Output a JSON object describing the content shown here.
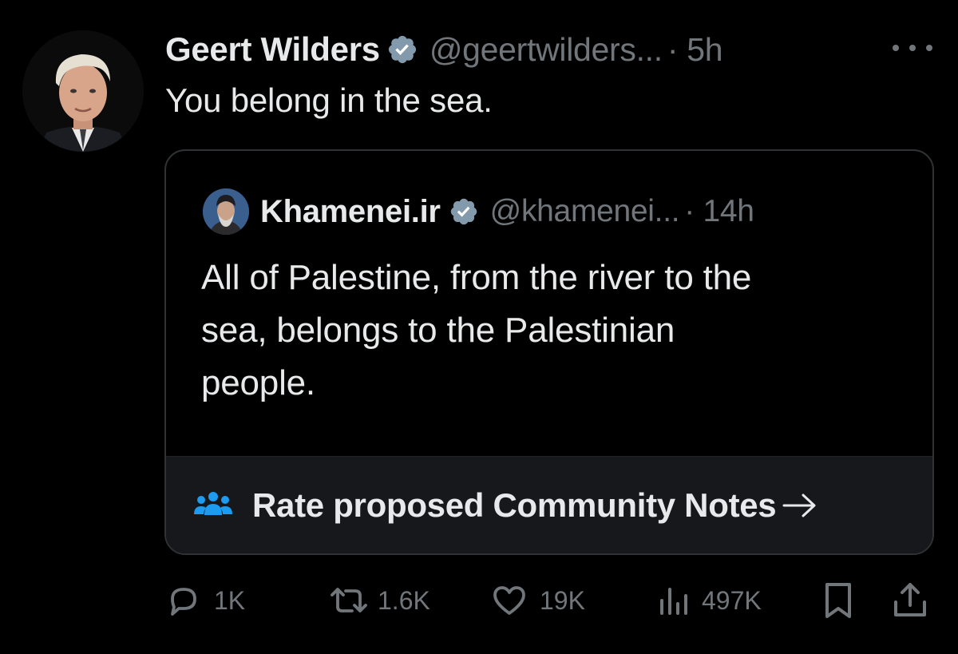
{
  "tweet": {
    "author_name": "Geert Wilders",
    "author_handle": "@geertwilders...",
    "time": "· 5h",
    "text": "You belong in the sea."
  },
  "quoted": {
    "author_name": "Khamenei.ir",
    "author_handle": "@khamenei...",
    "time": "· 14h",
    "text_lines": [
      "All of Palestine, from the river to the",
      "sea, belongs to the Palestinian",
      "people."
    ]
  },
  "community_notes": {
    "label": "Rate proposed Community Notes",
    "icon": "people-icon",
    "icon_color": "#1d9bf0"
  },
  "actions": {
    "replies": "1K",
    "retweets": "1.6K",
    "likes": "19K",
    "views": "497K"
  },
  "colors": {
    "background": "#000000",
    "text": "#e7e9ea",
    "secondary": "#71767b",
    "verified_badge": "#829aab",
    "accent": "#1d9bf0"
  }
}
